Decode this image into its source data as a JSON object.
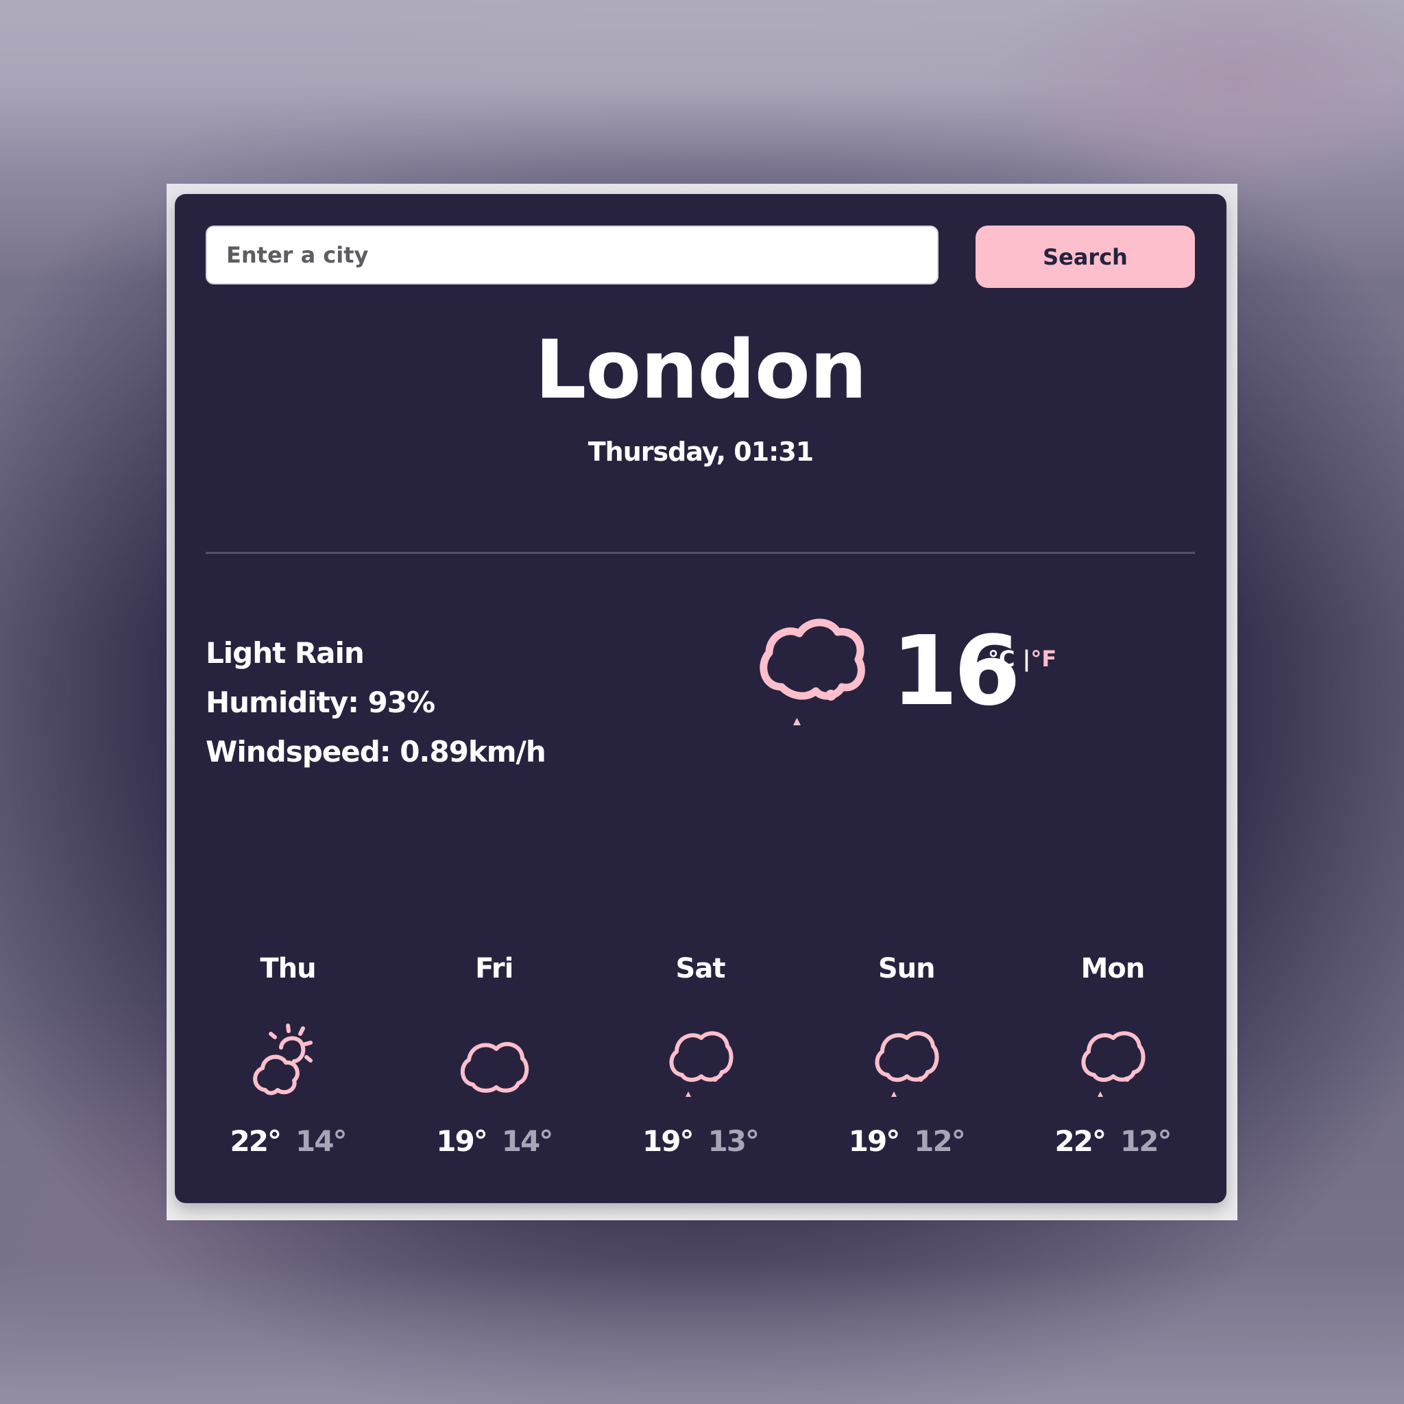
{
  "search": {
    "placeholder": "Enter a city",
    "value": "",
    "button_label": "Search"
  },
  "current": {
    "city": "London",
    "datetime": "Thursday, 01:31",
    "description": "Light Rain",
    "humidity_label": "Humidity: 93%",
    "windspeed_label": "Windspeed: 0.89km/h",
    "icon": "rain-cloud-icon",
    "temperature": "16",
    "unit_c": "°C",
    "unit_separator": "|",
    "unit_f": "°F",
    "active_unit": "C"
  },
  "forecast": [
    {
      "day": "Thu",
      "icon": "partly-cloudy-icon",
      "max": "22°",
      "min": "14°"
    },
    {
      "day": "Fri",
      "icon": "cloud-icon",
      "max": "19°",
      "min": "14°"
    },
    {
      "day": "Sat",
      "icon": "rain-cloud-icon",
      "max": "19°",
      "min": "13°"
    },
    {
      "day": "Sun",
      "icon": "rain-cloud-icon",
      "max": "19°",
      "min": "12°"
    },
    {
      "day": "Mon",
      "icon": "rain-cloud-icon",
      "max": "22°",
      "min": "12°"
    }
  ],
  "colors": {
    "card_background": "#27233f",
    "accent_pink": "#fcbfcb",
    "text_primary": "#ffffff",
    "text_secondary": "#a8a5b8",
    "divider": "#534f6e"
  }
}
